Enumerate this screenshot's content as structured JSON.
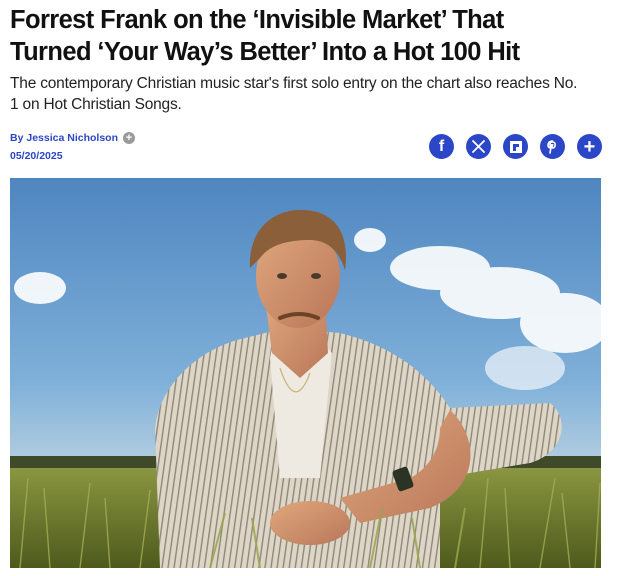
{
  "article": {
    "headline_line1": "Forrest Frank on the ‘Invisible Market’ That",
    "headline_line2": "Turned ‘Your Way’s Better’ Into a Hot 100 Hit",
    "dek_line1": "The contemporary Christian music star's first solo entry on the chart also reaches No.",
    "dek_line2": "1 on Hot Christian Songs.",
    "byline_prefix": "By",
    "author": "Jessica Nicholson",
    "date": "05/20/2025"
  },
  "share": {
    "facebook": "f",
    "x": "X",
    "flipboard": "flipboard",
    "pinterest": "P",
    "more": "+"
  },
  "hero_image": {
    "subject": "photo-of-man-crouching-in-tall-grass",
    "colors": {
      "sky": "#5b93c9",
      "grass": "#6f7a2e",
      "shirt": "#d9d2c2"
    }
  },
  "colors": {
    "accent": "#2c46c8",
    "text": "#111111"
  }
}
